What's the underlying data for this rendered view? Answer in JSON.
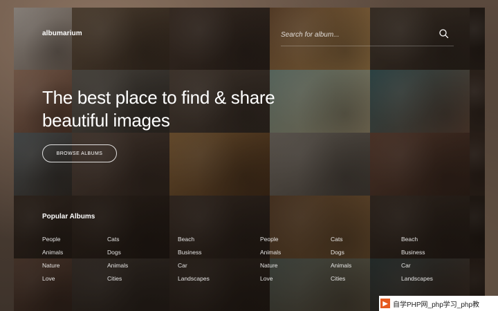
{
  "app": {
    "logo": "albumarium"
  },
  "search": {
    "placeholder": "Search for album...",
    "icon": "search-icon"
  },
  "hero": {
    "title_line1": "The best place to find & share",
    "title_line2": "beautiful images",
    "cta_label": "BROWSE ALBUMS"
  },
  "popular": {
    "heading": "Popular Albums",
    "columns": [
      [
        "People",
        "Animals",
        "Nature",
        "Love"
      ],
      [
        "Cats",
        "Dogs",
        "Animals",
        "Cities"
      ],
      [
        "Beach",
        "Business",
        "Car",
        "Landscapes"
      ],
      [
        "People",
        "Animals",
        "Nature",
        "Love"
      ],
      [
        "Cats",
        "Dogs",
        "Animals",
        "Cities"
      ],
      [
        "Beach",
        "Business",
        "Car",
        "Landscapes"
      ]
    ]
  },
  "watermark": {
    "text": "自学PHP网_php学习_php教"
  },
  "colors": {
    "accent_text": "#ffffff",
    "background": "#1c1713"
  }
}
